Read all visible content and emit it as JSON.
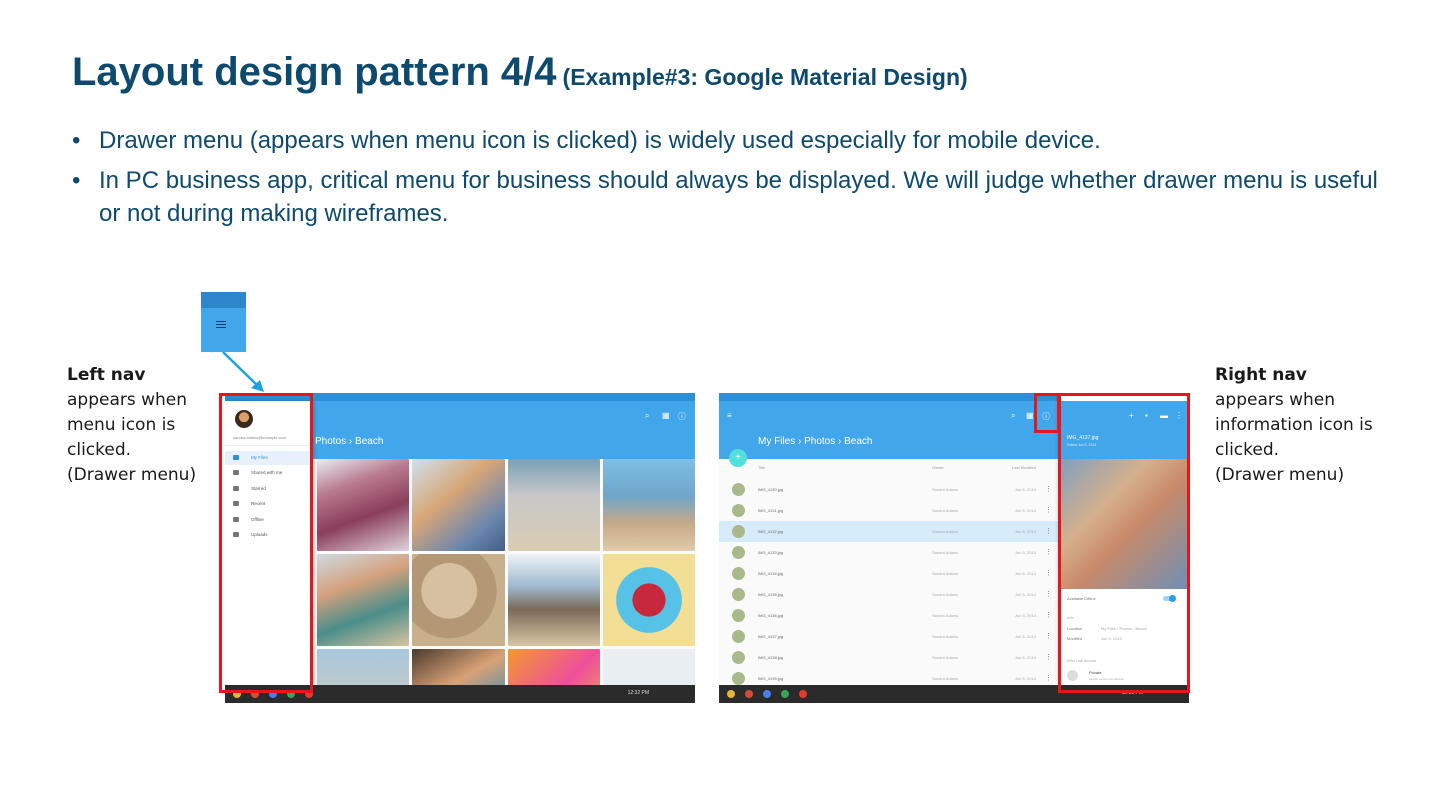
{
  "title": {
    "main": "Layout design pattern 4/4",
    "sub": "(Example#3: Google Material Design)"
  },
  "bullets": [
    "Drawer menu (appears when menu icon is clicked) is widely used especially for mobile device.",
    "In PC business app, critical menu for business should always be displayed. We will judge whether drawer menu is useful or not during making wireframes."
  ],
  "left_note": {
    "heading": "Left nav",
    "body": "appears when\nmenu icon is\nclicked.\n(Drawer menu)"
  },
  "right_note": {
    "heading": "Right nav",
    "body": "appears when\ninformation icon is\nclicked.\n(Drawer menu)"
  },
  "left_shot": {
    "breadcrumb": "Photos  ›  Beach",
    "account": "sandra.adams@example.com",
    "drawer_items": [
      "My Files",
      "Shared with me",
      "Starred",
      "Recent",
      "Offline",
      "Uploads"
    ],
    "selected_item": "My Files",
    "time": "12:32 PM"
  },
  "right_shot": {
    "breadcrumb": "My Files  ›  Photos  ›  Beach",
    "columns": [
      "Title",
      "Owner",
      "Last Modified"
    ],
    "files": [
      {
        "name": "IMG_4130.jpg",
        "owner": "Sandra Adams",
        "date": "Jun 5, 2014"
      },
      {
        "name": "IMG_4131.jpg",
        "owner": "Sandra Adams",
        "date": "Jun 5, 2014"
      },
      {
        "name": "IMG_4132.jpg",
        "owner": "Sandra Adams",
        "date": "Jun 5, 2014"
      },
      {
        "name": "IMG_4133.jpg",
        "owner": "Sandra Adams",
        "date": "Jun 5, 2014"
      },
      {
        "name": "IMG_4134.jpg",
        "owner": "Sandra Adams",
        "date": "Jun 5, 2014"
      },
      {
        "name": "IMG_4135.jpg",
        "owner": "Sandra Adams",
        "date": "Jun 5, 2014"
      },
      {
        "name": "IMG_4136.jpg",
        "owner": "Sandra Adams",
        "date": "Jun 5, 2014"
      },
      {
        "name": "IMG_4137.jpg",
        "owner": "Sandra Adams",
        "date": "Jun 5, 2014"
      },
      {
        "name": "IMG_4138.jpg",
        "owner": "Sandra Adams",
        "date": "Jun 5, 2014"
      },
      {
        "name": "IMG_4139.jpg",
        "owner": "Sandra Adams",
        "date": "Jun 5, 2014"
      }
    ],
    "selected_file": "IMG_4132.jpg",
    "info": {
      "name": "IMG_4137.jpg",
      "edited": "Edited Jun 5, 2014",
      "offline_label": "Available Offline",
      "info_heading": "Info",
      "location_label": "Location",
      "location_value": "My Files  ›  Photos  ›  Beach",
      "modified_label": "Modified",
      "modified_value": "Jun 5, 2014",
      "access_heading": "Who has access",
      "access_name": "Private",
      "access_sub": "people cannot can access"
    },
    "time": "12:32 PM"
  },
  "colors": {
    "title": "#0d4a6e",
    "app_bar": "#42a6ea",
    "highlight_box": "#e8151d",
    "fab": "#4fe0dc"
  }
}
